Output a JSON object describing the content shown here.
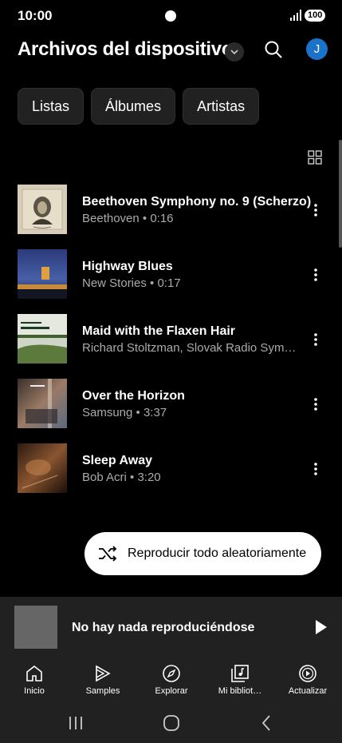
{
  "status": {
    "time": "10:00",
    "battery": "100"
  },
  "header": {
    "title": "Archivos del dispositivo",
    "avatar_initial": "J"
  },
  "chips": [
    "Listas",
    "Álbumes",
    "Artistas"
  ],
  "songs": [
    {
      "title": "Beethoven Symphony no. 9 (Scherzo)",
      "subtitle": "Beethoven • 0:16"
    },
    {
      "title": "Highway Blues",
      "subtitle": "New Stories • 0:17"
    },
    {
      "title": "Maid with the Flaxen Hair",
      "subtitle": "Richard Stoltzman, Slovak Radio Sym…"
    },
    {
      "title": "Over the Horizon",
      "subtitle": "Samsung • 3:37"
    },
    {
      "title": "Sleep Away",
      "subtitle": "Bob Acri • 3:20"
    }
  ],
  "shuffle": {
    "label": "Reproducir todo aleatoriamente"
  },
  "mini_player": {
    "text": "No hay nada reproduciéndose"
  },
  "nav": {
    "items": [
      {
        "label": "Inicio",
        "icon": "home-icon"
      },
      {
        "label": "Samples",
        "icon": "samples-icon"
      },
      {
        "label": "Explorar",
        "icon": "compass-icon"
      },
      {
        "label": "Mi bibliot…",
        "icon": "library-icon"
      },
      {
        "label": "Actualizar",
        "icon": "upgrade-icon"
      }
    ]
  },
  "colors": {
    "background": "#000000",
    "surface": "#212121",
    "avatar": "#1a73c8"
  }
}
